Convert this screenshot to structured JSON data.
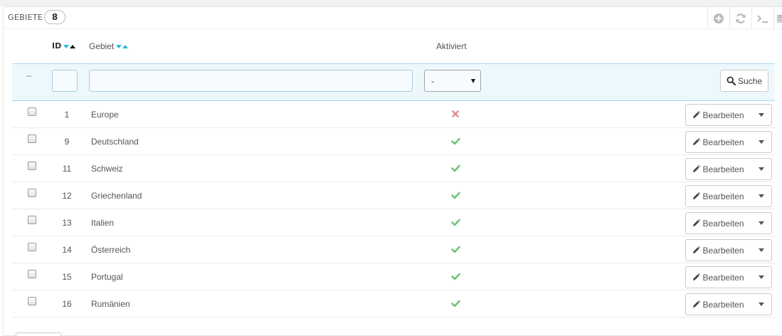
{
  "panel": {
    "title": "Gebiete",
    "count": "8",
    "toolbar": [
      {
        "name": "add-icon",
        "label": "Neu"
      },
      {
        "name": "refresh-icon",
        "label": "Aktualisieren"
      },
      {
        "name": "terminal-icon",
        "label": "SQL"
      },
      {
        "name": "database-icon",
        "label": "Datenbank"
      }
    ]
  },
  "table": {
    "columns": {
      "id": "ID",
      "name": "Gebiet",
      "active": "Aktiviert"
    },
    "filter": {
      "bulk_placeholder": "--",
      "id_value": "",
      "name_value": "",
      "active_value": "-",
      "search_label": "Suche"
    },
    "rows": [
      {
        "id": "1",
        "name": "Europe",
        "active": false,
        "action": "Bearbeiten"
      },
      {
        "id": "9",
        "name": "Deutschland",
        "active": true,
        "action": "Bearbeiten"
      },
      {
        "id": "11",
        "name": "Schweiz",
        "active": true,
        "action": "Bearbeiten"
      },
      {
        "id": "12",
        "name": "Griechenland",
        "active": true,
        "action": "Bearbeiten"
      },
      {
        "id": "13",
        "name": "Italien",
        "active": true,
        "action": "Bearbeiten"
      },
      {
        "id": "14",
        "name": "Österreich",
        "active": true,
        "action": "Bearbeiten"
      },
      {
        "id": "15",
        "name": "Portugal",
        "active": true,
        "action": "Bearbeiten"
      },
      {
        "id": "16",
        "name": "Rumänien",
        "active": true,
        "action": "Bearbeiten"
      }
    ]
  },
  "colors": {
    "accent": "#25b9d7",
    "active_check": "#72c279",
    "inactive_x": "#e08f95",
    "filter_bg": "#edf8fc"
  }
}
